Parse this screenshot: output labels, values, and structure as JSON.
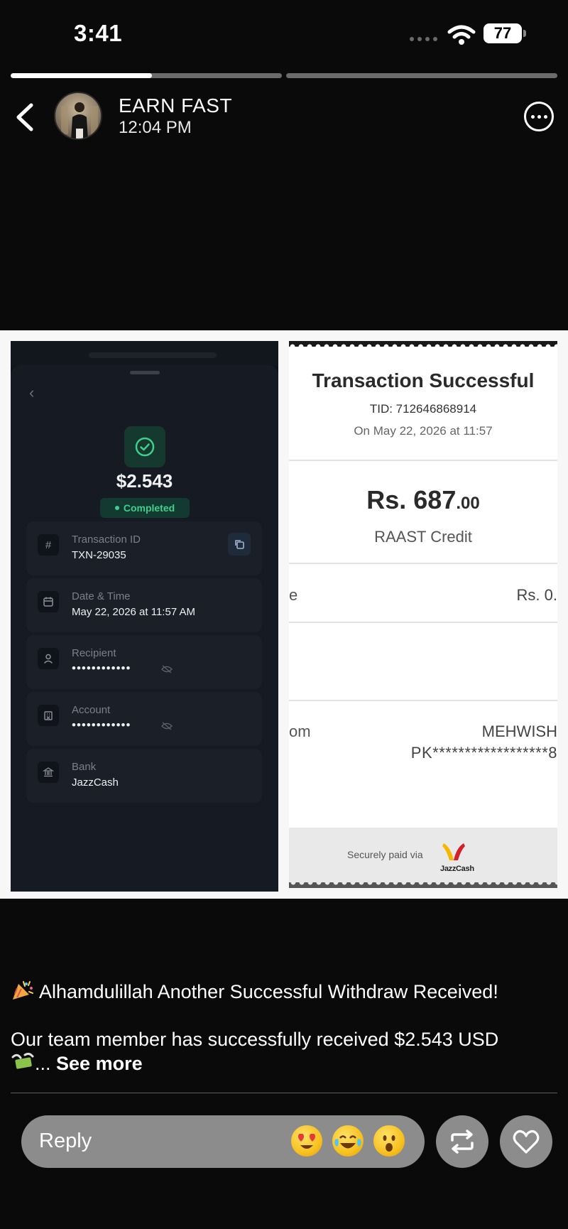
{
  "status_bar": {
    "time": "3:41",
    "battery": "77"
  },
  "story": {
    "progress": [
      0.52,
      0.0
    ],
    "username": "EARN FAST",
    "post_time": "12:04 PM"
  },
  "left_receipt": {
    "amount": "$2.543",
    "status": "Completed",
    "rows": [
      {
        "icon": "hash-icon",
        "label": "Transaction ID",
        "value": "TXN-29035"
      },
      {
        "icon": "calendar-icon",
        "label": "Date & Time",
        "value": "May 22, 2026 at 11:57 AM"
      },
      {
        "icon": "user-icon",
        "label": "Recipient",
        "value": "••••••••••••"
      },
      {
        "icon": "bank-building-icon",
        "label": "Account",
        "value": "••••••••••••"
      },
      {
        "icon": "bank-icon",
        "label": "Bank",
        "value": "JazzCash"
      }
    ]
  },
  "right_receipt": {
    "title": "Transaction Successful",
    "tid": "TID: 712646868914",
    "date": "On May 22, 2026 at 11:57",
    "amount_main": "Rs. 687",
    "amount_decimals": ".00",
    "type": "RAAST Credit",
    "fee_label": "e",
    "fee_value": "Rs. 0.",
    "from_label": "om",
    "name": "MEHWISH",
    "account": "PK******************8",
    "secure_text": "Securely paid via",
    "brand": "JazzCash"
  },
  "caption": {
    "line1": "Alhamdulillah Another Successful Withdraw Received!",
    "line2": "Our team member has successfully received $2.543 USD",
    "line3": "...",
    "see_more": "See more"
  },
  "reply": {
    "placeholder": "Reply",
    "emojis": [
      "heart-eyes-emoji",
      "tears-of-joy-emoji",
      "surprised-emoji"
    ]
  },
  "colors": {
    "background": "#0a0a0b",
    "success_green": "#3ecf8e",
    "pill": "#8c8c8c",
    "jazz_yellow": "#f5b800",
    "jazz_red": "#d4202a"
  }
}
